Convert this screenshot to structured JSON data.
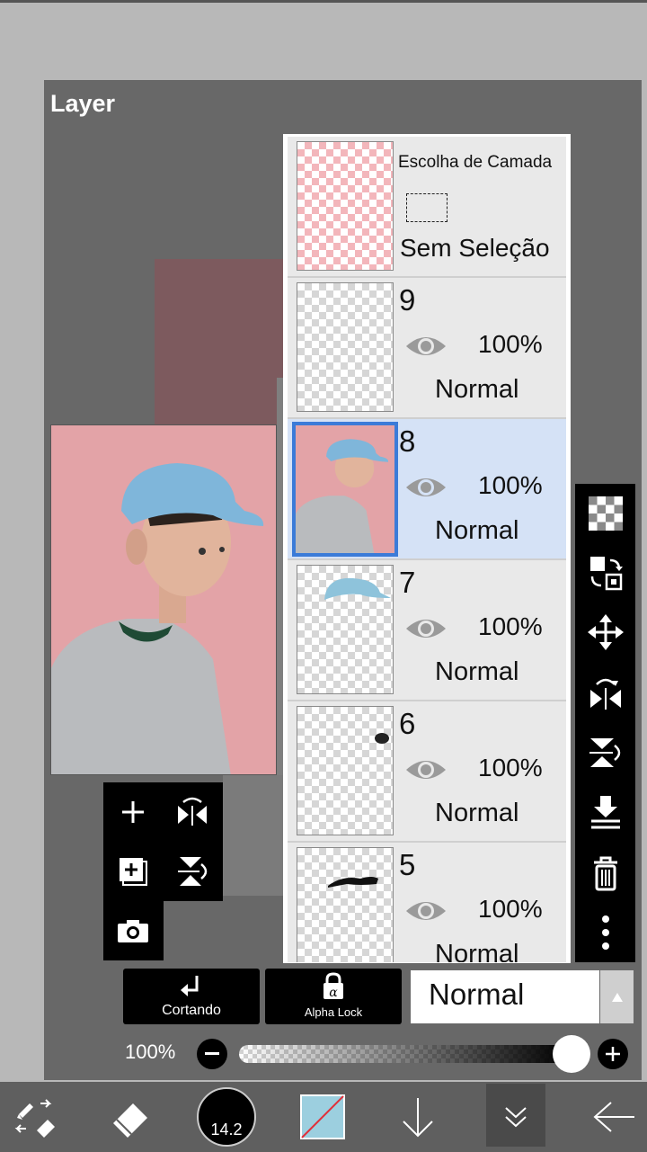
{
  "panel": {
    "title": "Layer"
  },
  "selection_row": {
    "title": "Escolha de Camada",
    "status": "Sem Seleção"
  },
  "layers": [
    {
      "number": "9",
      "opacity": "100%",
      "mode": "Normal"
    },
    {
      "number": "8",
      "opacity": "100%",
      "mode": "Normal",
      "selected": true
    },
    {
      "number": "7",
      "opacity": "100%",
      "mode": "Normal"
    },
    {
      "number": "6",
      "opacity": "100%",
      "mode": "Normal"
    },
    {
      "number": "5",
      "opacity": "100%",
      "mode": "Normal"
    }
  ],
  "bottom_controls": {
    "clipping_label": "Cortando",
    "alpha_lock_label": "Alpha Lock",
    "blend_mode": "Normal",
    "opacity_label": "100%",
    "opacity_value": 1.0
  },
  "toolbar": {
    "brush_size": "14.2"
  },
  "colors": {
    "accent": "#3b7bd8",
    "selected_row": "#d5e2f6",
    "primary_color": "#9ccfdf"
  },
  "icons": {
    "side_tools": [
      "checker-icon",
      "transfer-icon",
      "move-icon",
      "flip-horizontal-icon",
      "flip-vertical-icon",
      "merge-down-icon",
      "trash-icon",
      "more-icon"
    ],
    "grid_tools": [
      "add-layer-icon",
      "flip-layer-horizontal-icon",
      "duplicate-layer-icon",
      "flip-layer-vertical-icon",
      "camera-icon"
    ]
  }
}
